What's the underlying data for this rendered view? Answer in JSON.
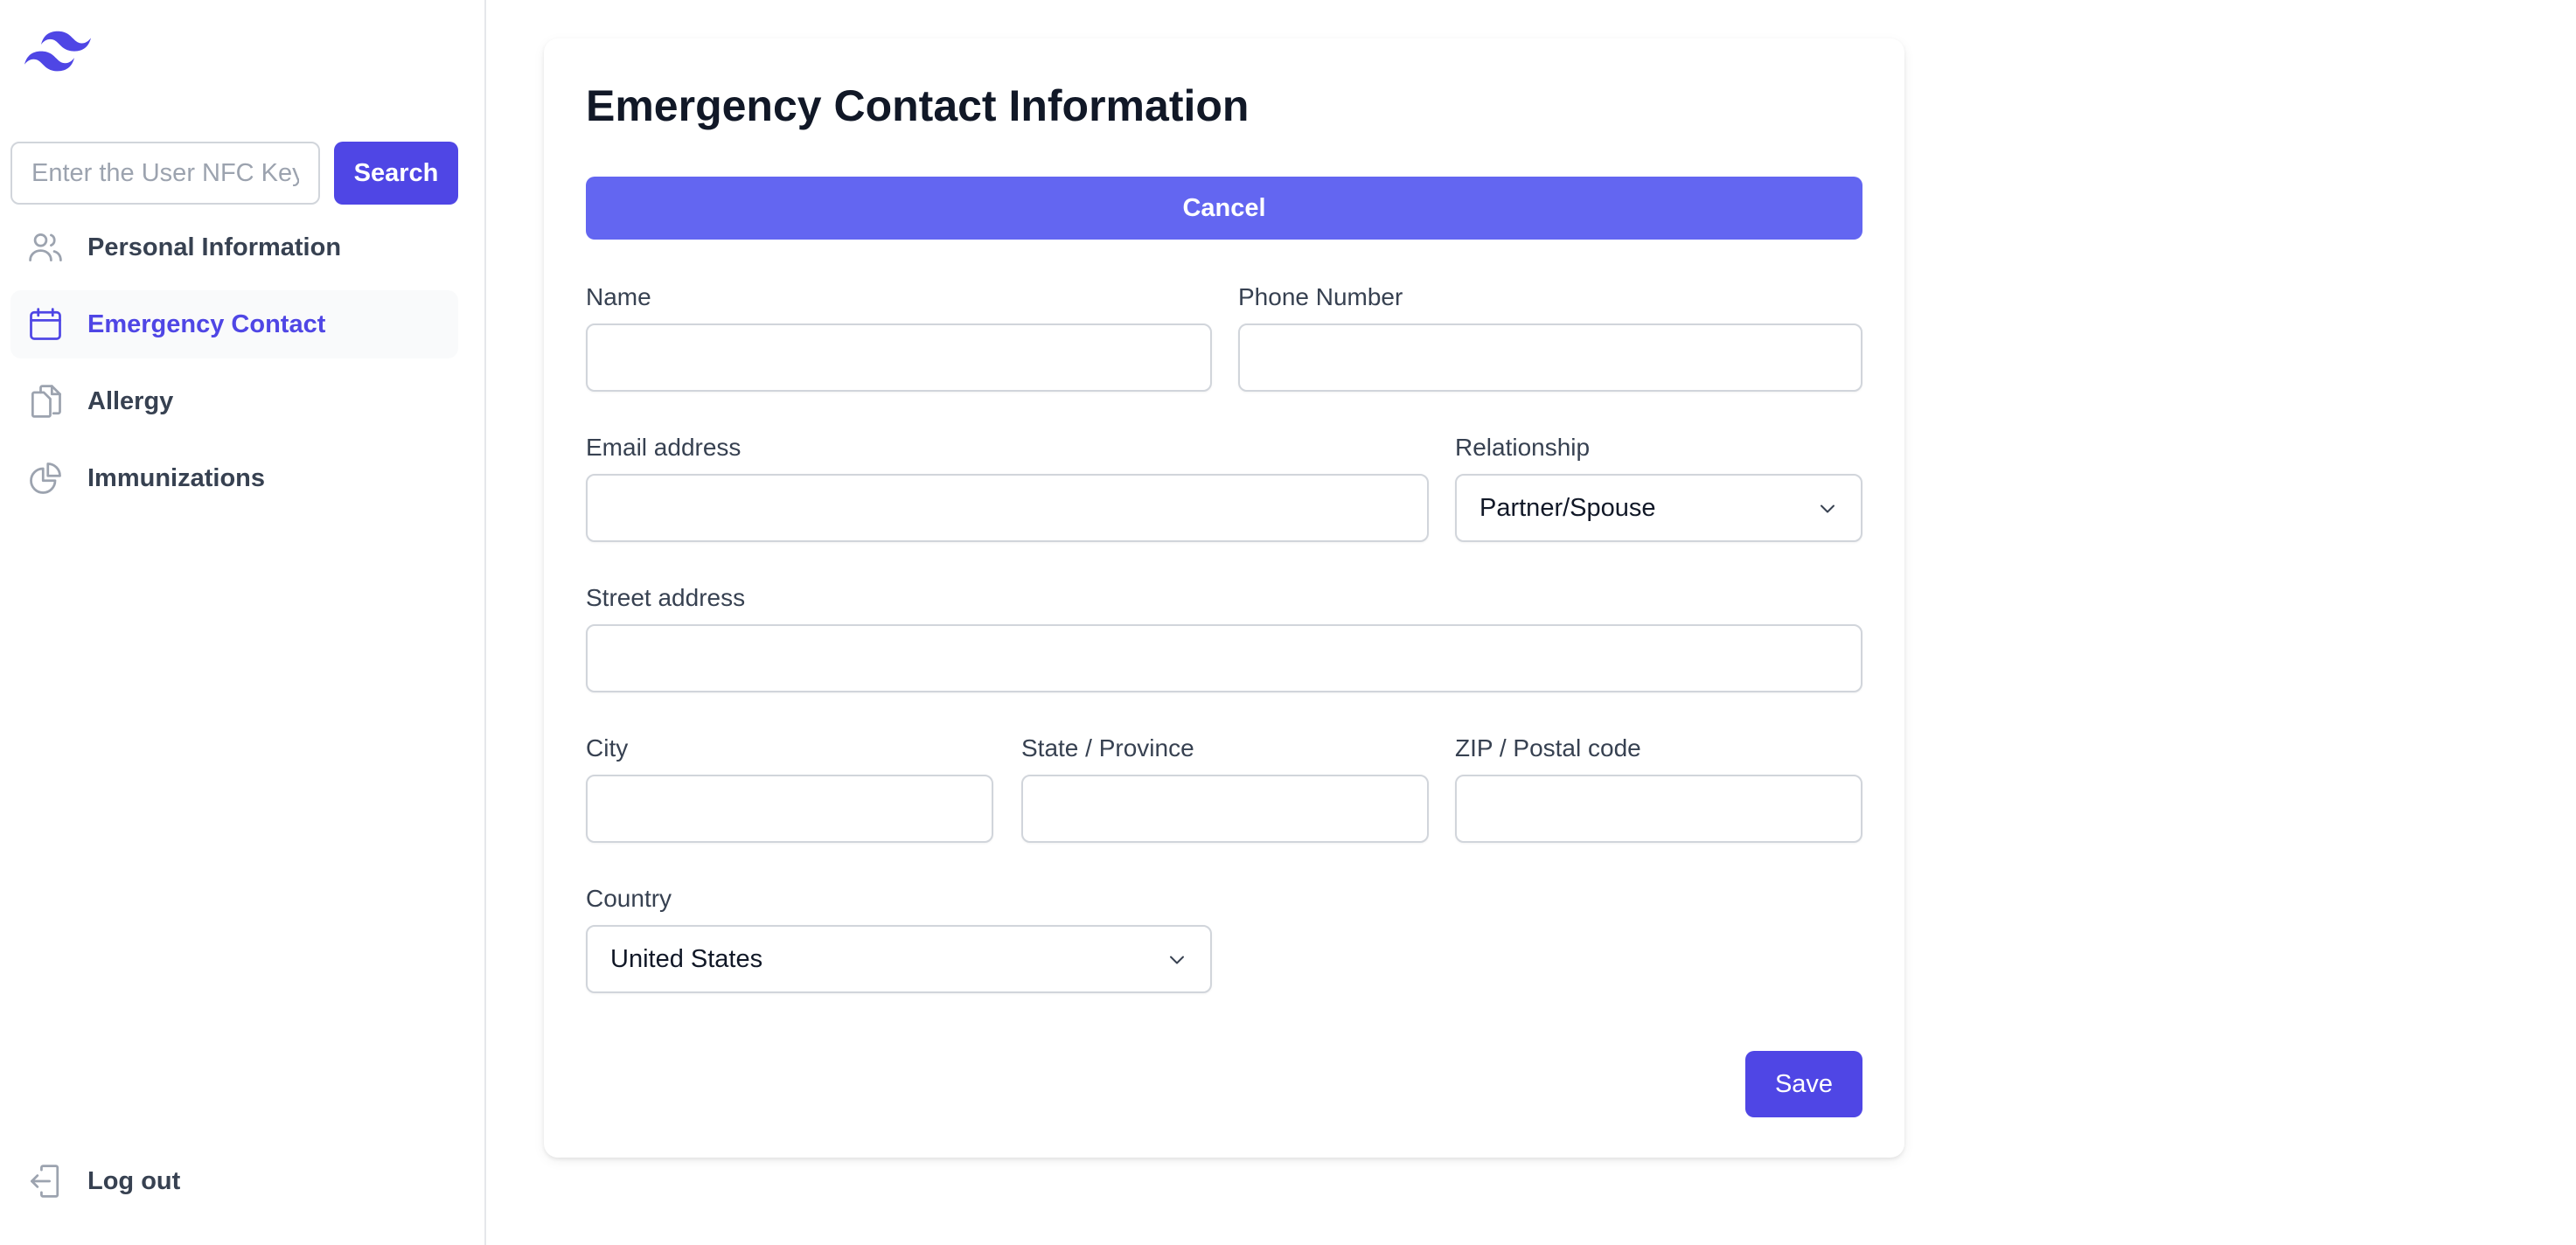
{
  "colors": {
    "accent": "#4f46e5",
    "cancel_bg": "#6366f1",
    "text_primary": "#111827",
    "text_muted": "#374151",
    "border": "#d1d5db"
  },
  "sidebar": {
    "logo_icon": "wave-logo-icon",
    "search": {
      "placeholder": "Enter the User NFC Key",
      "value": "",
      "button_label": "Search"
    },
    "items": [
      {
        "label": "Personal Information",
        "icon": "users-icon",
        "active": false
      },
      {
        "label": "Emergency Contact",
        "icon": "calendar-icon",
        "active": true
      },
      {
        "label": "Allergy",
        "icon": "documents-icon",
        "active": false
      },
      {
        "label": "Immunizations",
        "icon": "pie-chart-icon",
        "active": false
      }
    ],
    "logout_label": "Log out",
    "logout_icon": "logout-icon"
  },
  "main": {
    "title": "Emergency Contact Information",
    "cancel_label": "Cancel",
    "fields": {
      "name": {
        "label": "Name",
        "value": ""
      },
      "phone": {
        "label": "Phone Number",
        "value": ""
      },
      "email": {
        "label": "Email address",
        "value": ""
      },
      "relationship": {
        "label": "Relationship",
        "value": "Partner/Spouse"
      },
      "street": {
        "label": "Street address",
        "value": ""
      },
      "city": {
        "label": "City",
        "value": ""
      },
      "state": {
        "label": "State / Province",
        "value": ""
      },
      "zip": {
        "label": "ZIP / Postal code",
        "value": ""
      },
      "country": {
        "label": "Country",
        "value": "United States"
      }
    },
    "save_label": "Save"
  }
}
